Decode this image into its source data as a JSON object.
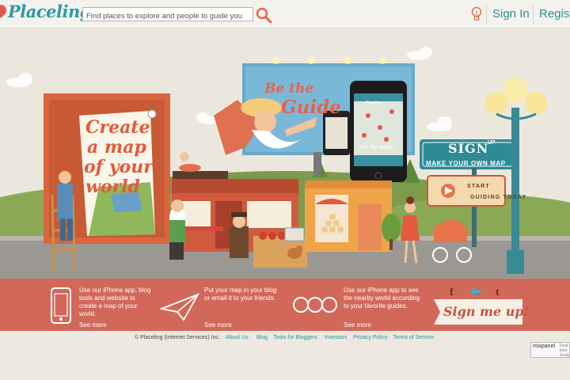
{
  "header": {
    "logo_text": "Placeling",
    "search_placeholder": "Find places to explore and people to guide you",
    "signin_label": "Sign In",
    "register_label": "Regist"
  },
  "hero": {
    "billboard_left_lines": [
      "Create",
      "a map",
      "of your",
      "world"
    ],
    "billboard_top_line1": "Be the",
    "billboard_top_line2": "Guide",
    "phone_caption": "You, the guide!",
    "phone_brand": "Placeling",
    "sign_title": "SIGN",
    "sign_title_sup": "UP",
    "sign_subtitle": "MAKE YOUR OWN MAP",
    "start_line1": "START",
    "start_line2": "GUIDING TODAY"
  },
  "features": [
    {
      "icon": "phone-icon",
      "text_lines": [
        "Use our iPhone app, blog",
        "tools and website to",
        "create a map of your",
        "world."
      ],
      "more": "See more"
    },
    {
      "icon": "paper-plane-icon",
      "text_lines": [
        "Put your map in your blog",
        "or email it to your friends."
      ],
      "more": "See more"
    },
    {
      "icon": "binoculars-icon",
      "text_lines": [
        "Use our iPhone app to see",
        "the nearby world according",
        "to your favorite guides."
      ],
      "more": "See more"
    }
  ],
  "social": {
    "facebook": "f",
    "twitter": "🐦",
    "tumblr": "t"
  },
  "signup_label": "Sign me up!",
  "footer": {
    "copyright": "© Placeling (Internet Services) Inc.",
    "links": [
      "About Us",
      "Blog",
      "Tools for Bloggers",
      "Investors",
      "Privacy Policy",
      "Terms of Service"
    ],
    "mixpanel_label": "mixpanel",
    "mixpanel_sub": "Real-time Analytics"
  },
  "colors": {
    "accent": "#2a9aa6",
    "band": "#d2685a",
    "brick": "#e2594b"
  }
}
